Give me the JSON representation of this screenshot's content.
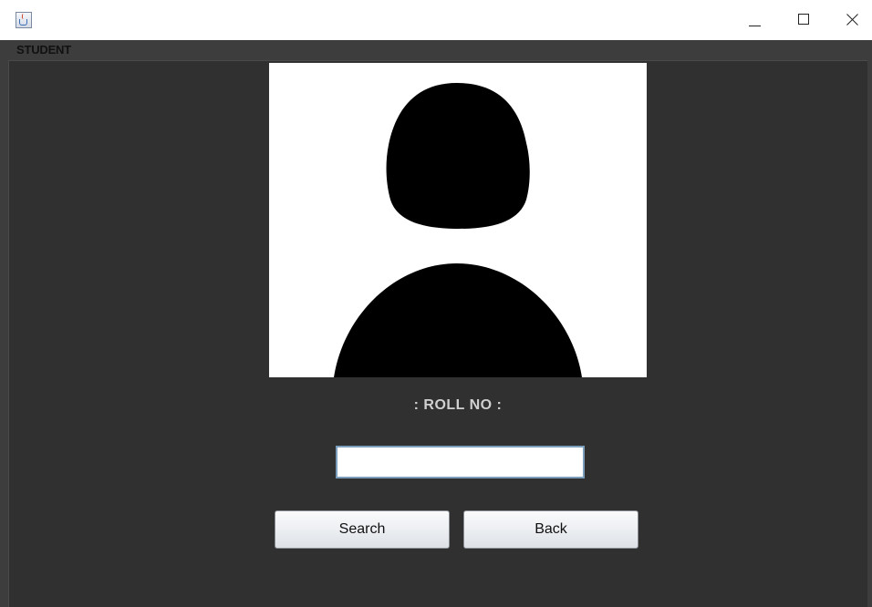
{
  "window": {
    "title": "",
    "controls": {
      "minimize": "minimize-icon",
      "maximize": "maximize-icon",
      "close": "close-icon"
    }
  },
  "frame": {
    "label": "STUDENT"
  },
  "form": {
    "roll_label": ":  ROLL NO  :",
    "roll_value": "",
    "search_label": "Search",
    "back_label": "Back"
  },
  "colors": {
    "content_bg": "#3d3d3d",
    "panel_bg": "#303030",
    "label_text": "#d0d0d0"
  },
  "icons": {
    "app": "java-coffee-cup-icon",
    "avatar": "user-silhouette-icon"
  }
}
